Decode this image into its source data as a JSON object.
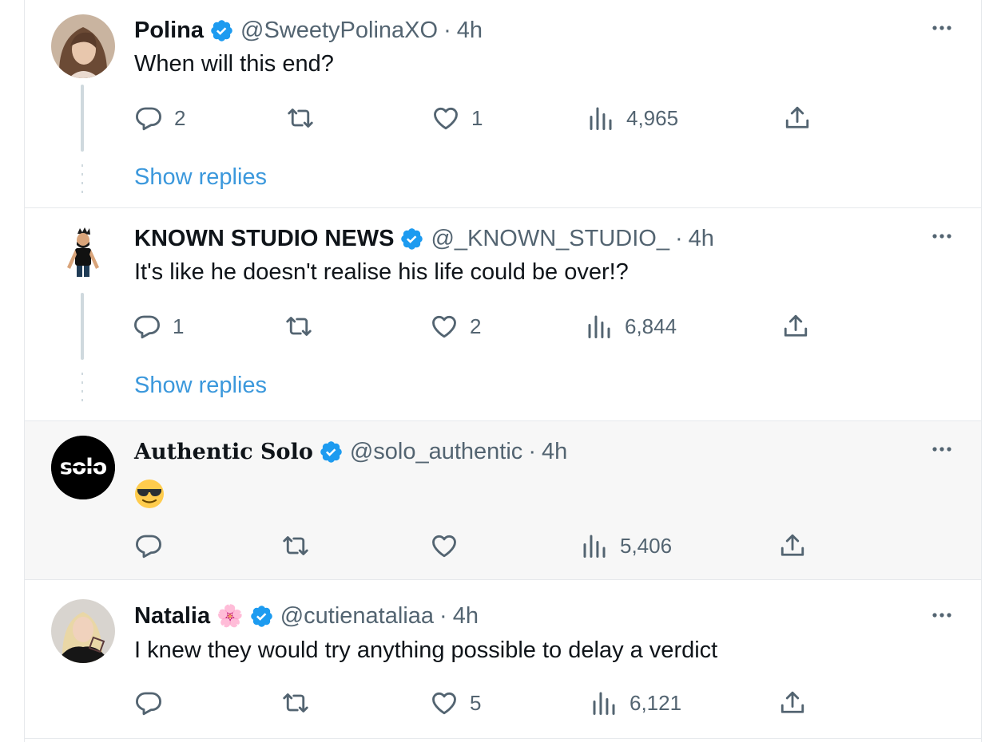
{
  "colors": {
    "link": "#3b98dc",
    "muted": "#536471",
    "text": "#0f1419",
    "verified": "#1d9bf0",
    "highlight_bg": "#f7f7f7"
  },
  "tweets": [
    {
      "name": "Polina",
      "handle": "@SweetyPolinaXO",
      "separator": "·",
      "time": "4h",
      "text": "When will this end?",
      "replies": "2",
      "retweets": "",
      "likes": "1",
      "views": "4,965",
      "show_replies": "Show replies"
    },
    {
      "name": "KNOWN STUDIO NEWS",
      "handle": "@_KNOWN_STUDIO_",
      "separator": "·",
      "time": "4h",
      "text": "It's like he doesn't realise his life could be over!?",
      "replies": "1",
      "retweets": "",
      "likes": "2",
      "views": "6,844",
      "show_replies": "Show replies"
    },
    {
      "name": "Authentic Solo",
      "handle": "@solo_authentic",
      "separator": "·",
      "time": "4h",
      "text": "",
      "avatar_text": "solo",
      "replies": "",
      "retweets": "",
      "likes": "",
      "views": "5,406"
    },
    {
      "name": "Natalia",
      "name_emoji": "🌸",
      "handle": "@cutienataliaa",
      "separator": "·",
      "time": "4h",
      "text": "I knew they would try anything possible to delay a verdict",
      "replies": "",
      "retweets": "",
      "likes": "5",
      "views": "6,121"
    }
  ]
}
